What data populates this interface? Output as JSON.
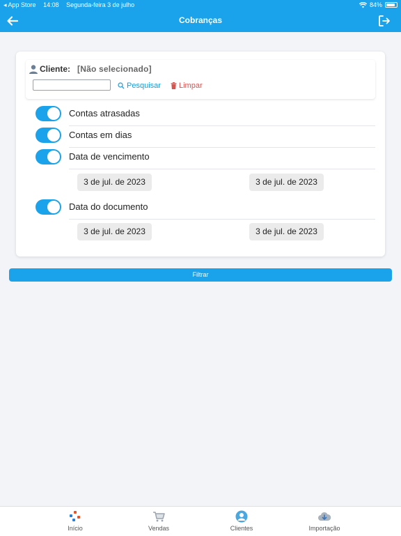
{
  "status_bar": {
    "back_app": "◂ App Store",
    "time": "14:08",
    "date": "Segunda-feira 3 de julho",
    "battery": "84%"
  },
  "header": {
    "title": "Cobranças"
  },
  "client": {
    "label": "Cliente:",
    "value": "[Não selecionado]",
    "input_value": "",
    "search_label": "Pesquisar",
    "clear_label": "Limpar"
  },
  "options": [
    {
      "label": "Contas atrasadas",
      "enabled": true
    },
    {
      "label": "Contas em dias",
      "enabled": true
    },
    {
      "label": "Data de vencimento",
      "enabled": true
    },
    {
      "label": "Data do documento",
      "enabled": true
    }
  ],
  "dates": {
    "vencimento_start": "3 de jul. de 2023",
    "vencimento_end": "3 de jul. de 2023",
    "documento_start": "3 de jul. de 2023",
    "documento_end": "3 de jul. de 2023"
  },
  "filter_button": "Filtrar",
  "tabs": [
    {
      "label": "Início",
      "icon": "home-dots-icon"
    },
    {
      "label": "Vendas",
      "icon": "cart-icon"
    },
    {
      "label": "Clientes",
      "icon": "user-circle-icon"
    },
    {
      "label": "Importação",
      "icon": "cloud-download-icon"
    }
  ],
  "colors": {
    "primary": "#1aa3ea",
    "danger": "#d9534f",
    "background": "#f2f4f8"
  }
}
